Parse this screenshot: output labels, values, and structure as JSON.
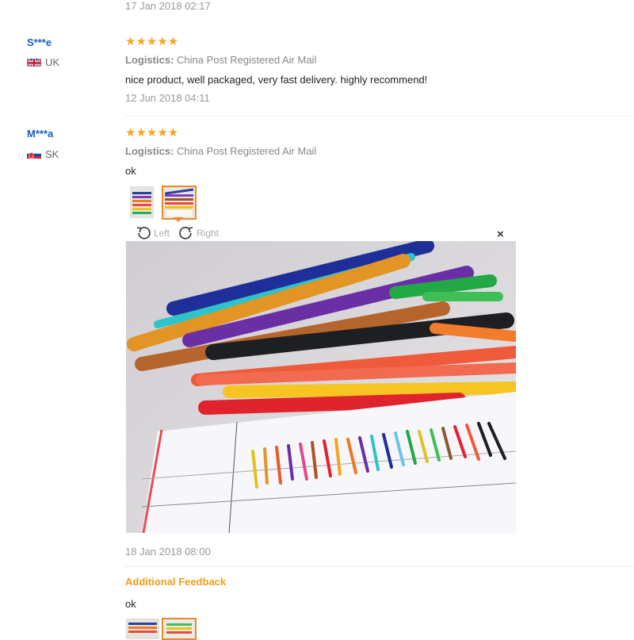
{
  "reviews": [
    {
      "date": "17 Jan 2018 02:17"
    },
    {
      "user": "S***e",
      "country": "UK",
      "stars": "★★★★★",
      "logistics_label": "Logistics:",
      "logistics_value": "China Post Registered Air Mail",
      "text": "nice product, well packaged, very fast delivery. highly recommend!",
      "date": "12 Jun 2018 04:11"
    },
    {
      "user": "M***a",
      "country": "SK",
      "stars": "★★★★★",
      "logistics_label": "Logistics:",
      "logistics_value": "China Post Registered Air Mail",
      "text": "ok",
      "date": "18 Jan 2018 08:00",
      "additional_title": "Additional Feedback",
      "additional_text": "ok"
    }
  ],
  "viewer": {
    "rotate_left": "Left",
    "rotate_right": "Right",
    "close": "×"
  },
  "colors": {
    "accent": "#f39c12",
    "user_link": "#1a5fb4",
    "star": "#f5a623",
    "active_thumb": "#e88a2a"
  }
}
